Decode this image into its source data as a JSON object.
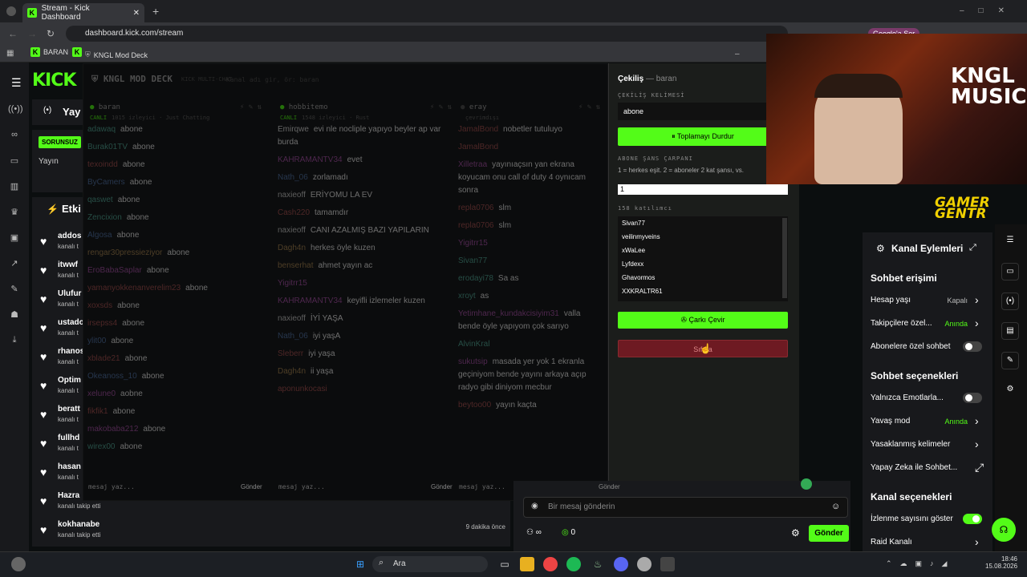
{
  "browser": {
    "tab_title": "Stream - Kick Dashboard",
    "url": "dashboard.kick.com/stream",
    "bookmarks": [
      "BARAN",
      "KNGL Mod Deck"
    ],
    "profile_button": "Google'a Ser"
  },
  "sidebar": {
    "logo": "KICK",
    "title_partial": "Yay",
    "badge": "SORUNSUZ",
    "sub": "Yayın",
    "events_label": "Etki"
  },
  "follows": [
    {
      "name": "addos",
      "sub": "kanalı t",
      "time": ""
    },
    {
      "name": "itwwf",
      "sub": "kanalı t",
      "time": ""
    },
    {
      "name": "Ulufur",
      "sub": "kanalı t",
      "time": ""
    },
    {
      "name": "ustado",
      "sub": "kanalı t",
      "time": ""
    },
    {
      "name": "rhanos",
      "sub": "kanalı t",
      "time": ""
    },
    {
      "name": "Optim",
      "sub": "kanalı t",
      "time": ""
    },
    {
      "name": "beratt",
      "sub": "kanalı t",
      "time": ""
    },
    {
      "name": "fullhd",
      "sub": "kanalı t",
      "time": ""
    },
    {
      "name": "hasan",
      "sub": "kanalı t",
      "time": ""
    },
    {
      "name": "Hazra",
      "sub": "kanalı takip etti",
      "time": ""
    },
    {
      "name": "kokhanabe",
      "sub": "kanalı takip etti",
      "time": "9 dakika önce"
    }
  ],
  "deck": {
    "title": "KNGL MOD DECK",
    "subtitle": "KICK MULTI-CHAT",
    "search_placeholder": "Kanal adı gir, ör: baran",
    "send": "Gönder",
    "input_placeholder": "mesaj yaz...",
    "columns": [
      {
        "name": "baran",
        "status": "CANLI",
        "info": "1015 izleyici · Just Chatting",
        "messages": [
          {
            "u": "adawaq",
            "m": "abone",
            "c": "#5a9"
          },
          {
            "u": "Burak01TV",
            "m": "abone",
            "c": "#5a9"
          },
          {
            "u": "texoindd",
            "m": "abone",
            "c": "#a55"
          },
          {
            "u": "ByCamers",
            "m": "abone",
            "c": "#57a"
          },
          {
            "u": "qaswet",
            "m": "abone",
            "c": "#5a9"
          },
          {
            "u": "Zencixion",
            "m": "abone",
            "c": "#5a9"
          },
          {
            "u": "Algosa",
            "m": "abone",
            "c": "#57a"
          },
          {
            "u": "rengar30pressieziyor",
            "m": "abone",
            "c": "#a85"
          },
          {
            "u": "EroBabaSaplar",
            "m": "abone",
            "c": "#a5a"
          },
          {
            "u": "yamanyokkenanverelim23",
            "m": "abone",
            "c": "#a55"
          },
          {
            "u": "xoxsds",
            "m": "abone",
            "c": "#a55"
          },
          {
            "u": "irsepss4",
            "m": "abone",
            "c": "#a55"
          },
          {
            "u": "ylit00",
            "m": "abone",
            "c": "#57a"
          },
          {
            "u": "xblade21",
            "m": "abone",
            "c": "#a55"
          },
          {
            "u": "Okeanoss_10",
            "m": "abone",
            "c": "#57a"
          },
          {
            "u": "xelune0",
            "m": "aobne",
            "c": "#a5a"
          },
          {
            "u": "fikfik1",
            "m": "abone",
            "c": "#a55"
          },
          {
            "u": "makobaba212",
            "m": "abone",
            "c": "#a5a"
          },
          {
            "u": "wirex00",
            "m": "abone",
            "c": "#5a9"
          }
        ]
      },
      {
        "name": "hobbitemo",
        "status": "CANLI",
        "info": "1548 izleyici · Rust",
        "messages": [
          {
            "u": "Emirqwe",
            "m": "evi nle nocliple yapıyo beyler ap var burda",
            "c": "#ddd"
          },
          {
            "u": "KAHRAMANTV34",
            "m": "evet",
            "c": "#a5a"
          },
          {
            "u": "Nath_06",
            "m": "zorlamadı",
            "c": "#57a"
          },
          {
            "u": "naxieoff",
            "m": "ERİYOMU LA EV",
            "c": "#ccc"
          },
          {
            "u": "Cash220",
            "m": "tamamdır",
            "c": "#a55"
          },
          {
            "u": "naxieoff",
            "m": "CANI AZALMIŞ BAZI YAPILARIN",
            "c": "#ccc"
          },
          {
            "u": "Dagh4n",
            "m": "herkes öyle kuzen",
            "c": "#a85"
          },
          {
            "u": "benserhat",
            "m": "ahmet yayın ac",
            "c": "#a85"
          },
          {
            "u": "Yigitrr15",
            "m": "",
            "c": "#a5a"
          },
          {
            "u": "KAHRAMANTV34",
            "m": "keyifli izlemeler kuzen",
            "c": "#a5a"
          },
          {
            "u": "naxieoff",
            "m": "İYİ YAŞA",
            "c": "#ccc"
          },
          {
            "u": "Nath_06",
            "m": "iyi yaşA",
            "c": "#57a"
          },
          {
            "u": "Sleberr",
            "m": "iyi yaşa",
            "c": "#a55"
          },
          {
            "u": "Dagh4n",
            "m": "ii yaşa",
            "c": "#a85"
          },
          {
            "u": "aponunkocasi",
            "m": "",
            "c": "#a55"
          }
        ]
      },
      {
        "name": "eray",
        "status": "",
        "info": "çevrimdışı",
        "messages": [
          {
            "u": "JamalBond",
            "m": "nobetler tutuluyo",
            "c": "#a55"
          },
          {
            "u": "JamalBond",
            "m": "",
            "c": "#a55"
          },
          {
            "u": "Xilletraa",
            "m": "yayınıaçsın yan ekrana koyucam onu call of duty 4 oynıcam sonra",
            "c": "#a5a"
          },
          {
            "u": "repla0706",
            "m": "slm",
            "c": "#a55"
          },
          {
            "u": "repla0706",
            "m": "slm",
            "c": "#a55"
          },
          {
            "u": "Yigitrr15",
            "m": "",
            "c": "#a5a"
          },
          {
            "u": "Sivan77",
            "m": "",
            "c": "#5a9"
          },
          {
            "u": "erodayi78",
            "m": "Sa as",
            "c": "#5a9"
          },
          {
            "u": "xroyt",
            "m": "as",
            "c": "#5a9"
          },
          {
            "u": "Yetimhane_kundakcisiyim31",
            "m": "valla bende öyle yapıyom çok sarıyo",
            "c": "#a5a"
          },
          {
            "u": "AlvinKral",
            "m": "",
            "c": "#5a9"
          },
          {
            "u": "sukutsip",
            "m": "masada yer yok 1 ekranla geçiniyom bende yayını arkaya açıp radyo gibi diniyom mecbur",
            "c": "#a5a"
          },
          {
            "u": "beytoo00",
            "m": "yayın kaçta",
            "c": "#a55"
          }
        ]
      }
    ]
  },
  "giveaway": {
    "title": "Çekiliş",
    "title_sub": "— baran",
    "keyword_label": "ÇEKİLİŞ KELİMESİ",
    "keyword": "abone",
    "stop_button": "⏸ Toplamayı Durdur",
    "multiplier_label": "ABONE ŞANS ÇARPANI",
    "multiplier_help": "1 = herkes eşit. 2 = aboneler 2 kat şansı, vs.",
    "multiplier_value": "1",
    "participants_label": "158 katılımcı",
    "participants": [
      "Sivan77",
      "veilinmyveins",
      "xWaLee",
      "Lyfdexx",
      "Ghavormos",
      "XXKRALTR61"
    ],
    "spin_button": "Çarkı Çevir",
    "reset_button": "Sıfırla"
  },
  "mod_panel": {
    "title": "Kanal Eylemleri",
    "section1": "Sohbet erişimi",
    "items1": [
      {
        "label": "Hesap yaşı",
        "value": "Kapalı"
      },
      {
        "label": "Takipçilere özel...",
        "value": "Anında"
      },
      {
        "label": "Abonelere özel sohbet",
        "value": ""
      }
    ],
    "section2": "Sohbet seçenekleri",
    "items2": [
      {
        "label": "Yalnızca Emotlarla...",
        "value": ""
      },
      {
        "label": "Yavaş mod",
        "value": "Anında"
      },
      {
        "label": "Yasaklanmış kelimeler",
        "value": ""
      },
      {
        "label": "Yapay Zeka ile Sohbet...",
        "value": ""
      }
    ],
    "section3": "Kanal seçenekleri",
    "items3": [
      {
        "label": "İzlenme sayısını göster",
        "value": ""
      },
      {
        "label": "Raid Kanalı",
        "value": ""
      }
    ]
  },
  "chat": {
    "placeholder": "Bir mesaj gönderin",
    "send": "Gönder",
    "count": "0"
  },
  "webcam": {
    "overlay1": "KNGL MUSIC",
    "overlay2": "GAMER GENTR"
  },
  "taskbar": {
    "search": "Ara",
    "time": "18:46",
    "date": "15.08.2026"
  }
}
